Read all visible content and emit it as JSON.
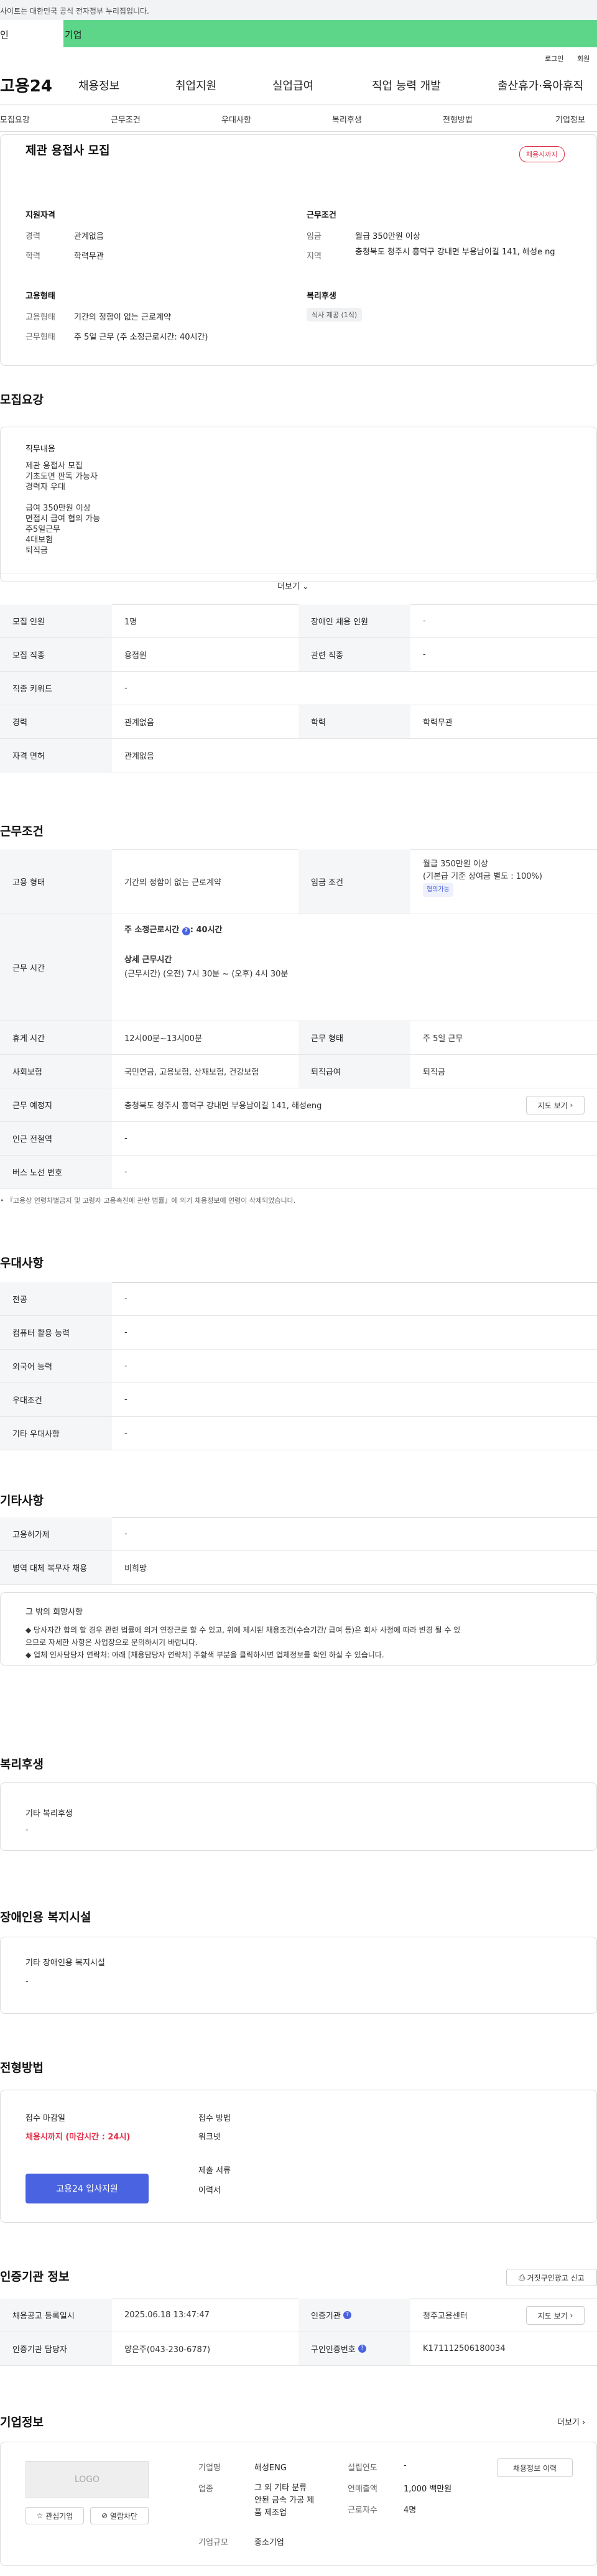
{
  "gov_notice": "사이트는 대한민국 공식 전자정부 누리집입니다.",
  "tabs": [
    "인",
    "기업"
  ],
  "util": [
    "로그인",
    "회원"
  ],
  "gnb": {
    "logo": "고용24",
    "menu": [
      "채용정보",
      "취업지원",
      "실업급여",
      "직업 능력 개발",
      "출산휴가·육아휴직"
    ]
  },
  "subnav": [
    "모집요강",
    "근무조건",
    "우대사항",
    "복리후생",
    "전형방법",
    "기업정보"
  ],
  "summary": {
    "title": "제관 용접사 모집",
    "status_badge": "채용시까지",
    "groups": [
      {
        "title": "지원자격",
        "rows": [
          [
            "경력",
            "관계없음"
          ],
          [
            "학력",
            "학력무관"
          ]
        ]
      },
      {
        "title": "근무조건",
        "rows": [
          [
            "임금",
            "월급 350만원 이상"
          ],
          [
            "지역",
            "충청북도 청주시 흥덕구 강내면 부용남이길 141, 해성e ng"
          ]
        ]
      },
      {
        "title": "고용형태",
        "rows": [
          [
            "고용형태",
            "기간의 정함이 없는 근로계약"
          ],
          [
            "근무형태",
            "주 5일 근무 (주 소정근로시간: 40시간)"
          ]
        ]
      },
      {
        "title": "복리후생",
        "chips": [
          "식사 제공 (1식)"
        ]
      }
    ]
  },
  "recruit": {
    "title": "모집요강",
    "duty_title": "직무내용",
    "duty_lines": [
      "제관 용접사 모집",
      "기초도면 판독 가능자",
      "경력자 우대",
      "",
      "급여 350만원 이상",
      "면접시 급여 협의 가능",
      "주5일근무",
      "4대보험",
      "퇴직금"
    ],
    "more": "더보기",
    "table": [
      [
        [
          "모집 인원",
          "1명"
        ],
        [
          "장애인 채용 인원",
          "-"
        ]
      ],
      [
        [
          "모집 직종",
          "용접원"
        ],
        [
          "관련 직종",
          "-"
        ]
      ],
      [
        [
          "직종 키워드",
          "-"
        ]
      ],
      [
        [
          "경력",
          "관계없음"
        ],
        [
          "학력",
          "학력무관"
        ]
      ],
      [
        [
          "자격 면허",
          "관계없음"
        ]
      ]
    ]
  },
  "conditions": {
    "title": "근무조건",
    "employ_label": "고용 형태",
    "employ_value": "기간의 정함이 없는 근로계약",
    "wage_label": "임금 조건",
    "wage_lines": [
      "월급 350만원 이상",
      "(기본급 기준 상여금 별도 : 100%)"
    ],
    "wage_chip": "협의가능",
    "time_label": "근무 시간",
    "time_weekly": "주 소정근로시간",
    "time_weekly_value": ": 40시간",
    "time_detail_title": "상세 근무시간",
    "time_detail": "(근무시간) (오전) 7시 30분 ~ (오후) 4시 30분",
    "rest_label": "휴게 시간",
    "rest_value": "12시00분~13시00분",
    "worktype_label": "근무 형태",
    "worktype_value": "주 5일 근무",
    "insurance_label": "사회보험",
    "insurance_value": "국민연금, 고용보험, 산재보험, 건강보험",
    "retire_label": "퇴직급여",
    "retire_value": "퇴직금",
    "place_label": "근무 예정지",
    "place_value": "충청북도 청주시 흥덕구 강내면 부용남이길 141, 해성eng",
    "map_button": "지도 보기",
    "subway_label": "인근 전철역",
    "subway_value": "-",
    "bus_label": "버스 노선 번호",
    "bus_value": "-",
    "note": "『고용상 연령차별금지 및 고령자 고용촉진에 관한 법률』에 의거 채용정보에 연령이 삭제되었습니다."
  },
  "preference": {
    "title": "우대사항",
    "rows": [
      [
        "전공",
        "-"
      ],
      [
        "컴퓨터 활용 능력",
        "-"
      ],
      [
        "외국어 능력",
        "-"
      ],
      [
        "우대조건",
        "-"
      ],
      [
        "기타 우대사항",
        "-"
      ]
    ]
  },
  "etc": {
    "title": "기타사항",
    "rows": [
      [
        "고용허가제",
        "-"
      ],
      [
        "병역 대체 복무자 채용",
        "비희망"
      ]
    ],
    "notice_title": "그 밖의 희망사항",
    "notice_lines": [
      "◆ 당사자간 합의 할 경우 관련 법률에 의거 연장근로 할 수 있고, 위에 제시된 채용조건(수습기간/ 급여 등)은 회사 사정에 따라 변경 될 수 있",
      "으므로 자세한 사항은 사업장으로 문의하시기 바랍니다.",
      "◆ 업체 인사담당자 연락처: 아래 [채용담당자 연락처] 주황색 부분을 클릭하시면 업체정보를 확인 하실 수 있습니다."
    ]
  },
  "welfare": {
    "title": "복리후생",
    "sub": "기타 복리후생",
    "value": "-"
  },
  "disabled": {
    "title": "장애인용 복지시설",
    "sub": "기타 장애인용 복지시설",
    "value": "-"
  },
  "process": {
    "title": "전형방법",
    "deadline_label": "접수 마감일",
    "deadline_value": "채용시까지 (마감시간 : 24시)",
    "apply_button": "고용24 입사지원",
    "method_label": "접수 방법",
    "method_value": "워크넷",
    "docs_label": "제출 서류",
    "docs_value": "이력서"
  },
  "auth": {
    "title": "인증기관 정보",
    "report_button": "거짓구인광고 신고",
    "rows": [
      [
        [
          "채용공고 등록일시",
          "2025.06.18 13:47:47"
        ],
        [
          "인증기관",
          "청주고용센터"
        ]
      ],
      [
        [
          "인증기관 담당자",
          "양은주(043-230-6787)"
        ],
        [
          "구인인증번호",
          "K171112506180034"
        ]
      ]
    ],
    "map_button": "지도 보기"
  },
  "company": {
    "title": "기업정보",
    "more": "더보기",
    "logo_text": "LOGO",
    "interest_button": "관심기업",
    "block_button": "열람차단",
    "name_label": "기업명",
    "name_value": "해성ENG",
    "industry_label": "업종",
    "industry_lines": [
      "그 외 기타 분류",
      "안된 금속 가공 제",
      "품 제조업"
    ],
    "size_label": "기업규모",
    "size_value": "중소기업",
    "founded_label": "설립연도",
    "founded_value": "-",
    "sales_label": "연매출액",
    "sales_value": "1,000 백만원",
    "employees_label": "근로자수",
    "employees_value": "4명",
    "jobs_button": "채용정보 이력"
  },
  "colors": {
    "accent_green": "#5dd68a",
    "status_red": "#e2314a",
    "apply_blue": "#4a63e0"
  }
}
